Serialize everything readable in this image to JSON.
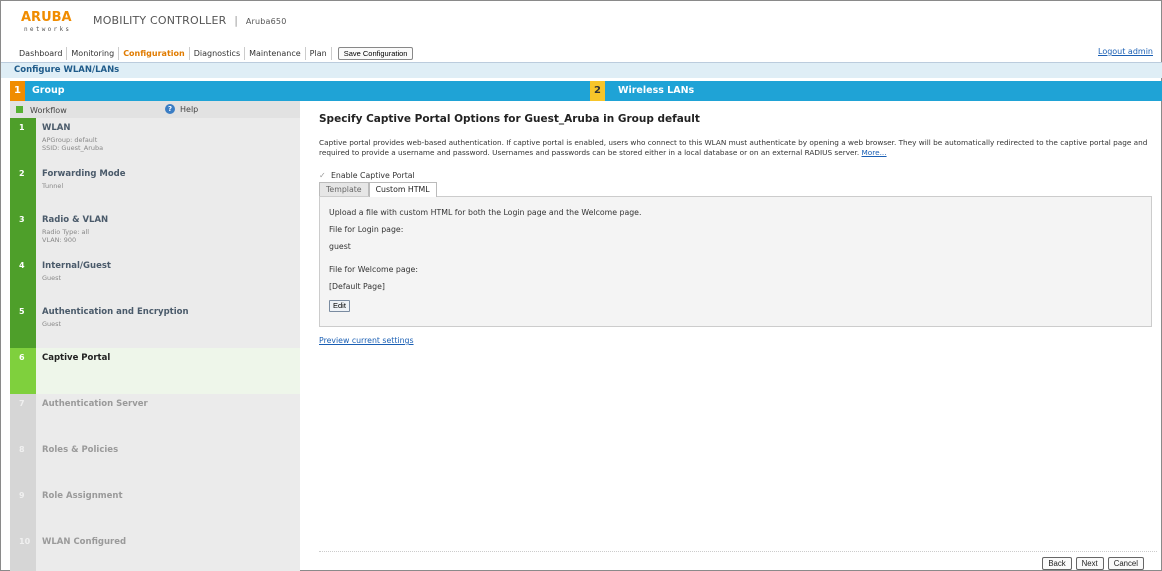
{
  "header": {
    "logo_text": "ARUBA",
    "logo_sub": "networks",
    "product": "MOBILITY CONTROLLER",
    "separator": "|",
    "hostname": "Aruba650"
  },
  "nav": {
    "items": [
      {
        "label": "Dashboard",
        "active": false
      },
      {
        "label": "Monitoring",
        "active": false
      },
      {
        "label": "Configuration",
        "active": true
      },
      {
        "label": "Diagnostics",
        "active": false
      },
      {
        "label": "Maintenance",
        "active": false
      },
      {
        "label": "Plan",
        "active": false
      }
    ],
    "save_label": "Save Configuration",
    "logout_label": "Logout admin"
  },
  "subheader": {
    "title": "Configure WLAN/LANs"
  },
  "stepbars": {
    "left": {
      "number": "1",
      "label": "Group"
    },
    "right": {
      "number": "2",
      "label": "Wireless LANs"
    }
  },
  "sidebar": {
    "workflow_label": "Workflow",
    "help_label": "Help",
    "help_glyph": "?",
    "steps": [
      {
        "number": "1",
        "title": "WLAN",
        "details": [
          "APGroup: default",
          "SSID: Guest_Aruba"
        ],
        "state": "done"
      },
      {
        "number": "2",
        "title": "Forwarding Mode",
        "details": [
          "Tunnel"
        ],
        "state": "done"
      },
      {
        "number": "3",
        "title": "Radio & VLAN",
        "details": [
          "Radio Type: all",
          "VLAN: 900"
        ],
        "state": "done"
      },
      {
        "number": "4",
        "title": "Internal/Guest",
        "details": [
          "Guest"
        ],
        "state": "done"
      },
      {
        "number": "5",
        "title": "Authentication and Encryption",
        "details": [
          "Guest"
        ],
        "state": "done"
      },
      {
        "number": "6",
        "title": "Captive Portal",
        "details": [],
        "state": "current"
      },
      {
        "number": "7",
        "title": "Authentication Server",
        "details": [],
        "state": "todo"
      },
      {
        "number": "8",
        "title": "Roles & Policies",
        "details": [],
        "state": "todo"
      },
      {
        "number": "9",
        "title": "Role Assignment",
        "details": [],
        "state": "todo"
      },
      {
        "number": "10",
        "title": "WLAN Configured",
        "details": [],
        "state": "todo"
      }
    ]
  },
  "main": {
    "title": "Specify Captive Portal Options for Guest_Aruba in Group default",
    "description": "Captive portal provides web-based authentication. If captive portal is enabled, users who connect to this WLAN must authenticate by opening a web browser. They will be automatically redirected to the captive portal page and required to provide a username and password. Usernames and passwords can be stored either in a local database or on an external RADIUS server.",
    "more_label": "More...",
    "enable_label": "Enable Captive Portal",
    "enable_checked": true,
    "tabs": [
      {
        "label": "Template",
        "active": false
      },
      {
        "label": "Custom HTML",
        "active": true
      }
    ],
    "panel": {
      "intro": "Upload a file with custom HTML for both the Login page and the Welcome page.",
      "login_label": "File for Login page:",
      "login_value": "guest",
      "welcome_label": "File for Welcome page:",
      "welcome_value": "[Default Page]",
      "edit_label": "Edit"
    },
    "preview_label": "Preview current settings"
  },
  "footer": {
    "back_label": "Back",
    "next_label": "Next",
    "cancel_label": "Cancel"
  },
  "colors": {
    "accent_orange": "#f08c00",
    "step_blue": "#1fa3d6",
    "done_green": "#4e9f2a",
    "current_green": "#7fd03d",
    "link_blue": "#1a5fb4"
  }
}
